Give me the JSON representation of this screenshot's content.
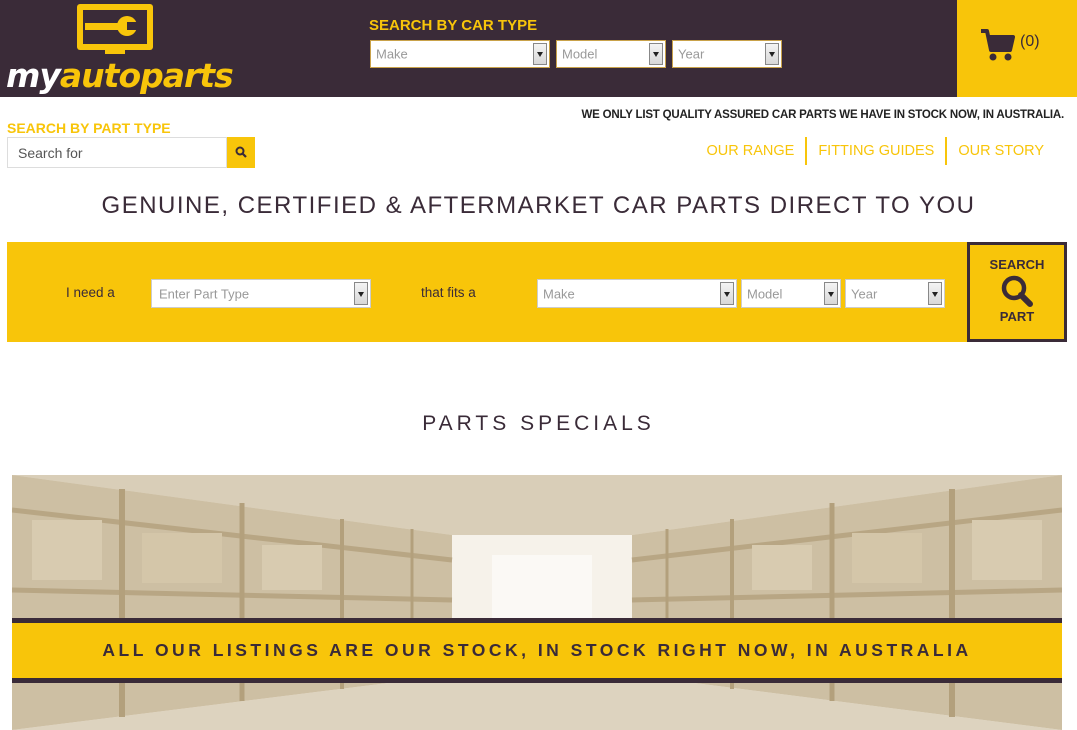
{
  "header": {
    "logo": {
      "my": "my",
      "auto": "auto",
      "parts": "parts"
    },
    "car_search_label": "SEARCH BY CAR TYPE",
    "car_make": "Make",
    "car_model": "Model",
    "car_year": "Year",
    "cart_count": "(0)"
  },
  "part_search": {
    "label": "SEARCH BY PART TYPE",
    "placeholder": "Search for"
  },
  "tagline": "WE ONLY LIST QUALITY ASSURED CAR PARTS WE HAVE IN STOCK NOW, IN AUSTRALIA.",
  "nav": [
    "OUR RANGE",
    "FITTING GUIDES",
    "OUR STORY"
  ],
  "headline": "GENUINE, CERTIFIED & AFTERMARKET CAR PARTS DIRECT TO YOU",
  "finder": {
    "i_need": "I need a",
    "part_type": "Enter Part Type",
    "fits": "that fits a",
    "make": "Make",
    "model": "Model",
    "year": "Year",
    "search_line1": "SEARCH",
    "search_line2": "PART"
  },
  "specials_title": "PARTS SPECIALS",
  "banner_text": "ALL OUR LISTINGS ARE OUR STOCK, IN STOCK RIGHT NOW, IN AUSTRALIA",
  "colors": {
    "brand_dark": "#3a2b38",
    "brand_yellow": "#f8c50a"
  }
}
